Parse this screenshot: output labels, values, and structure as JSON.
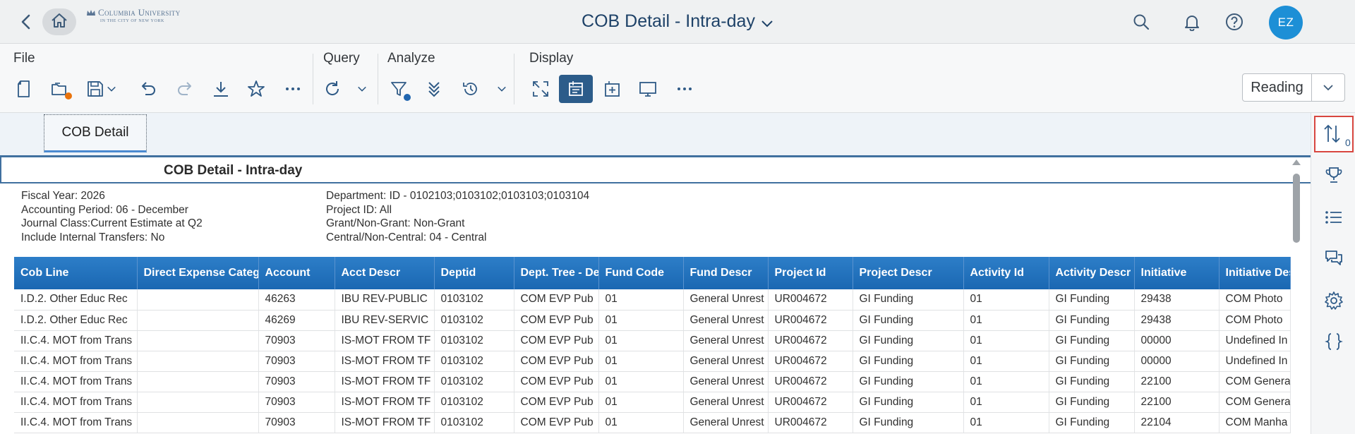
{
  "shell": {
    "logo_line1": "Columbia University",
    "logo_line2": "IN THE CITY OF NEW YORK",
    "title": "COB Detail - Intra-day",
    "avatar_initials": "EZ"
  },
  "toolbar": {
    "groups": {
      "file": "File",
      "query": "Query",
      "analyze": "Analyze",
      "display": "Display"
    },
    "view_mode": "Reading",
    "status_dot_color": "#e9730c",
    "info_dot_color": "#2166b0"
  },
  "tabs": {
    "active": "COB Detail"
  },
  "rail": {
    "sort_count": "0"
  },
  "report": {
    "title": "COB Detail - Intra-day",
    "filters_left": [
      "Fiscal Year: 2026",
      "Accounting Period: 06 - December",
      "Journal Class:Current Estimate at Q2",
      "Include Internal Transfers: No"
    ],
    "filters_right": [
      "Department: ID - 0102103;0103102;0103103;0103104",
      "Project ID: All",
      "Grant/Non-Grant: Non-Grant",
      "Central/Non-Central: 04 - Central"
    ],
    "columns": [
      "Cob Line",
      "Direct Expense Category",
      "Account",
      "Acct Descr",
      "Deptid",
      "Dept. Tree - Descr",
      "Fund Code",
      "Fund Descr",
      "Project Id",
      "Project Descr",
      "Activity Id",
      "Activity Descr",
      "Initiative",
      "Initiative Descr"
    ],
    "rows": [
      [
        "I.D.2. Other Educ Rec",
        "",
        "46263",
        "IBU REV-PUBLIC",
        "0103102",
        "COM EVP Pub",
        "01",
        "General Unrest",
        "UR004672",
        "GI Funding",
        "01",
        "GI Funding",
        "29438",
        "COM Photo"
      ],
      [
        "I.D.2. Other Educ Rec",
        "",
        "46269",
        "IBU REV-SERVIC",
        "0103102",
        "COM EVP Pub",
        "01",
        "General Unrest",
        "UR004672",
        "GI Funding",
        "01",
        "GI Funding",
        "29438",
        "COM Photo"
      ],
      [
        "II.C.4. MOT from Trans",
        "",
        "70903",
        "IS-MOT FROM TF",
        "0103102",
        "COM EVP Pub",
        "01",
        "General Unrest",
        "UR004672",
        "GI Funding",
        "01",
        "GI Funding",
        "00000",
        "Undefined In"
      ],
      [
        "II.C.4. MOT from Trans",
        "",
        "70903",
        "IS-MOT FROM TF",
        "0103102",
        "COM EVP Pub",
        "01",
        "General Unrest",
        "UR004672",
        "GI Funding",
        "01",
        "GI Funding",
        "00000",
        "Undefined In"
      ],
      [
        "II.C.4. MOT from Trans",
        "",
        "70903",
        "IS-MOT FROM TF",
        "0103102",
        "COM EVP Pub",
        "01",
        "General Unrest",
        "UR004672",
        "GI Funding",
        "01",
        "GI Funding",
        "22100",
        "COM Genera"
      ],
      [
        "II.C.4. MOT from Trans",
        "",
        "70903",
        "IS-MOT FROM TF",
        "0103102",
        "COM EVP Pub",
        "01",
        "General Unrest",
        "UR004672",
        "GI Funding",
        "01",
        "GI Funding",
        "22100",
        "COM Genera"
      ],
      [
        "II.C.4. MOT from Trans",
        "",
        "70903",
        "IS-MOT FROM TF",
        "0103102",
        "COM EVP Pub",
        "01",
        "General Unrest",
        "UR004672",
        "GI Funding",
        "01",
        "GI Funding",
        "22104",
        "COM Manha"
      ]
    ]
  }
}
